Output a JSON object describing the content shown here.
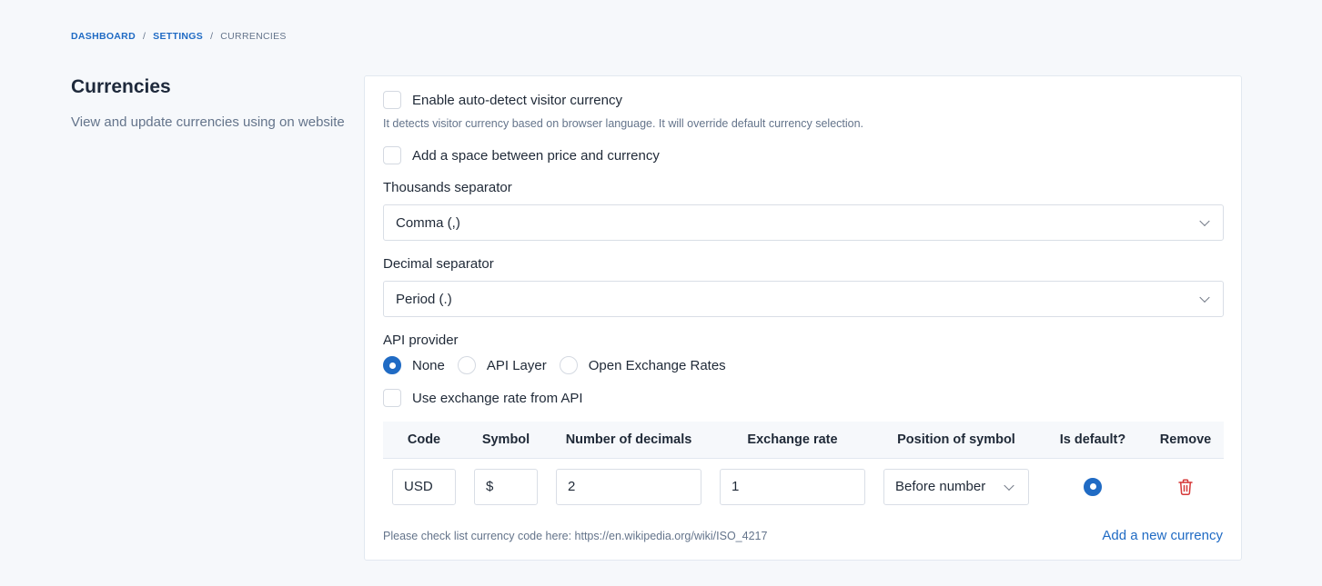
{
  "breadcrumb": {
    "dashboard": "DASHBOARD",
    "settings": "SETTINGS",
    "current": "CURRENCIES",
    "sep": "/"
  },
  "side": {
    "title": "Currencies",
    "description": "View and update currencies using on website"
  },
  "form": {
    "auto_detect_label": "Enable auto-detect visitor currency",
    "auto_detect_hint": "It detects visitor currency based on browser language. It will override default currency selection.",
    "space_label": "Add a space between price and currency",
    "thousands_label": "Thousands separator",
    "thousands_value": "Comma (,)",
    "decimal_label": "Decimal separator",
    "decimal_value": "Period (.)",
    "api_label": "API provider",
    "api_options": [
      "None",
      "API Layer",
      "Open Exchange Rates"
    ],
    "api_selected": "None",
    "use_api_rate_label": "Use exchange rate from API"
  },
  "table": {
    "headers": [
      "Code",
      "Symbol",
      "Number of decimals",
      "Exchange rate",
      "Position of symbol",
      "Is default?",
      "Remove"
    ],
    "rows": [
      {
        "code": "USD",
        "symbol": "$",
        "decimals": "2",
        "rate": "1",
        "position": "Before number",
        "is_default": true
      }
    ]
  },
  "footer": {
    "hint": "Please check list currency code here: https://en.wikipedia.org/wiki/ISO_4217",
    "add_link": "Add a new currency"
  },
  "colors": {
    "accent": "#206bc4",
    "danger": "#d63939",
    "background": "#f6f8fb"
  },
  "icons": {
    "remove": "trash-icon"
  }
}
